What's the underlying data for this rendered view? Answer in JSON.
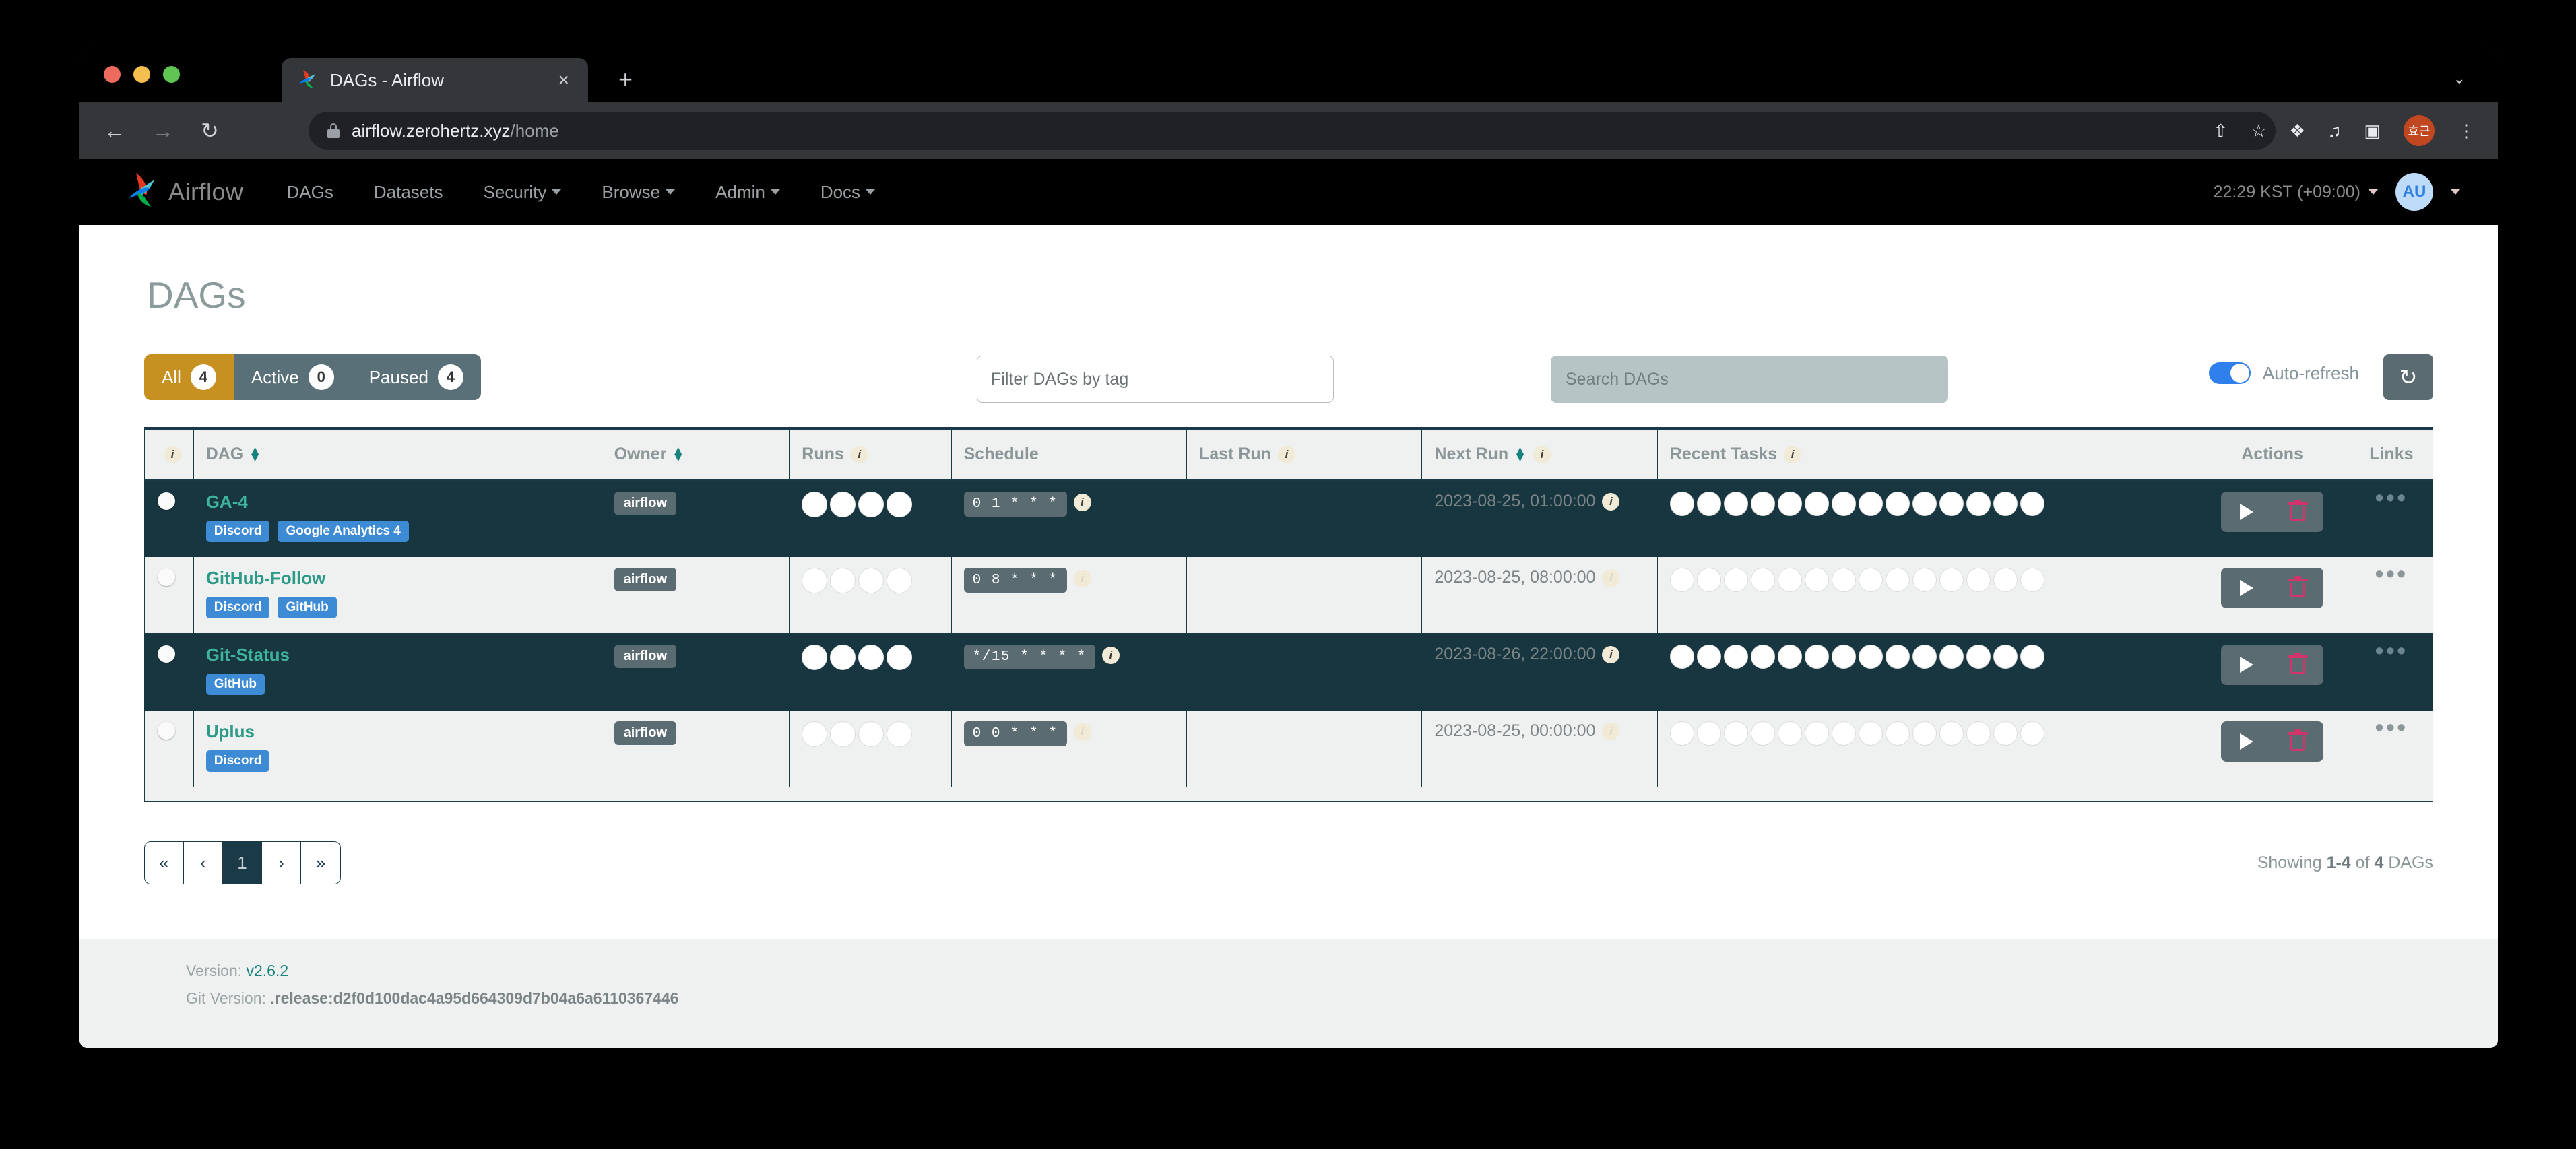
{
  "browser": {
    "tab_title": "DAGs - Airflow",
    "tab_close": "×",
    "new_tab": "+",
    "tab_list_chevron": "⌄",
    "back": "←",
    "forward": "→",
    "reload": "↻",
    "url_main": "airflow.zerohertz.xyz",
    "url_path": "/home",
    "share_icon": "⇧",
    "star_icon": "☆",
    "extensions_icon": "❖",
    "media_icon": "♫",
    "sidepanel_icon": "▣",
    "profile_initials": "효근",
    "menu_icon": "⋮"
  },
  "navbar": {
    "brand": "Airflow",
    "links": [
      {
        "label": "DAGs",
        "has_caret": false
      },
      {
        "label": "Datasets",
        "has_caret": false
      },
      {
        "label": "Security",
        "has_caret": true
      },
      {
        "label": "Browse",
        "has_caret": true
      },
      {
        "label": "Admin",
        "has_caret": true
      },
      {
        "label": "Docs",
        "has_caret": true
      }
    ],
    "clock": "22:29 KST (+09:00)",
    "avatar_initials": "AU"
  },
  "page": {
    "title": "DAGs"
  },
  "toolbar": {
    "pills": [
      {
        "label": "All",
        "count": "4",
        "active": true
      },
      {
        "label": "Active",
        "count": "0",
        "active": false
      },
      {
        "label": "Paused",
        "count": "4",
        "active": false
      }
    ],
    "filter_placeholder": "Filter DAGs by tag",
    "search_placeholder": "Search DAGs",
    "autorefresh_label": "Auto-refresh",
    "refresh_icon": "↻"
  },
  "table": {
    "headers": [
      {
        "label": "",
        "sortable": false,
        "info": false,
        "teal": false
      },
      {
        "label": "DAG",
        "sortable": true,
        "info": false,
        "teal": true
      },
      {
        "label": "Owner",
        "sortable": true,
        "info": false,
        "teal": true
      },
      {
        "label": "Runs",
        "sortable": false,
        "info": true,
        "teal": false
      },
      {
        "label": "Schedule",
        "sortable": false,
        "info": false,
        "teal": false
      },
      {
        "label": "Last Run",
        "sortable": false,
        "info": true,
        "teal": false
      },
      {
        "label": "Next Run",
        "sortable": true,
        "info": true,
        "teal": true
      },
      {
        "label": "Recent Tasks",
        "sortable": false,
        "info": true,
        "teal": false
      },
      {
        "label": "Actions",
        "sortable": false,
        "info": false,
        "teal": false
      },
      {
        "label": "Links",
        "sortable": false,
        "info": false,
        "teal": false
      }
    ],
    "rows": [
      {
        "name": "GA-4",
        "paused": true,
        "tags": [
          "Discord",
          "Google Analytics 4"
        ],
        "owner": "airflow",
        "runs_count": 4,
        "schedule": "0 1 * * *",
        "last_run": "",
        "next_run": "2023-08-25, 01:00:00",
        "recent_tasks_count": 14,
        "links": "•••",
        "highlighted": true
      },
      {
        "name": "GitHub-Follow",
        "paused": true,
        "tags": [
          "Discord",
          "GitHub"
        ],
        "owner": "airflow",
        "runs_count": 4,
        "schedule": "0 8 * * *",
        "last_run": "",
        "next_run": "2023-08-25, 08:00:00",
        "recent_tasks_count": 14,
        "links": "•••",
        "highlighted": false
      },
      {
        "name": "Git-Status",
        "paused": true,
        "tags": [
          "GitHub"
        ],
        "owner": "airflow",
        "runs_count": 4,
        "schedule": "*/15 * * * *",
        "last_run": "",
        "next_run": "2023-08-26, 22:00:00",
        "recent_tasks_count": 14,
        "links": "•••",
        "highlighted": true
      },
      {
        "name": "Uplus",
        "paused": true,
        "tags": [
          "Discord"
        ],
        "owner": "airflow",
        "runs_count": 4,
        "schedule": "0 0 * * *",
        "last_run": "",
        "next_run": "2023-08-25, 00:00:00",
        "recent_tasks_count": 14,
        "links": "•••",
        "highlighted": false
      }
    ]
  },
  "pagination": {
    "first": "«",
    "prev": "‹",
    "current": "1",
    "next": "›",
    "last": "»",
    "showing_prefix": "Showing ",
    "showing_range": "1-4",
    "showing_mid": " of ",
    "showing_total": "4",
    "showing_suffix": " DAGs"
  },
  "footer": {
    "version_label": "Version: ",
    "version_value": "v2.6.2",
    "git_label": "Git Version: ",
    "git_value": ".release:d2f0d100dac4a95d664309d7b04a6a6110367446"
  },
  "colors": {
    "accent_teal": "#18837e",
    "active_pill": "#c79121",
    "pill_bg": "#5a7079",
    "row_highlight": "#18363f",
    "tag_blue": "#3d8bd4",
    "delete_pink": "#d6336c"
  }
}
